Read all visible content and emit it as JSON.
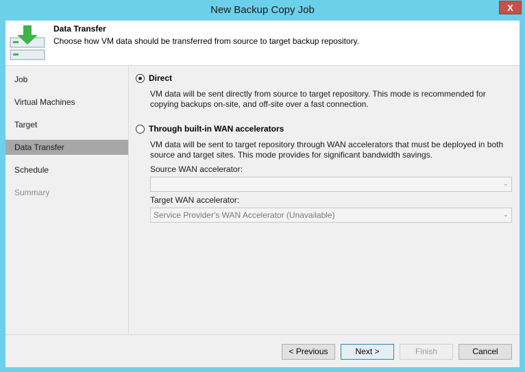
{
  "window": {
    "title": "New Backup Copy Job",
    "close_glyph": "X"
  },
  "header": {
    "title": "Data Transfer",
    "description": "Choose how VM data should be transferred from source to target backup repository.",
    "icon": "data-transfer-arrow-icon"
  },
  "nav": {
    "items": [
      {
        "label": "Job",
        "state": "normal"
      },
      {
        "label": "Virtual Machines",
        "state": "normal"
      },
      {
        "label": "Target",
        "state": "normal"
      },
      {
        "label": "Data Transfer",
        "state": "active"
      },
      {
        "label": "Schedule",
        "state": "normal"
      },
      {
        "label": "Summary",
        "state": "disabled"
      }
    ]
  },
  "options": {
    "direct": {
      "label": "Direct",
      "checked": true,
      "description": "VM data will be sent directly from source to target repository. This mode is recommended for copying backups on-site, and off-site over a fast connection."
    },
    "wan": {
      "label": "Through built-in WAN accelerators",
      "checked": false,
      "description": "VM data will be sent to target repository through WAN accelerators that must be deployed in both source and target sites. This mode provides for significant bandwidth savings."
    }
  },
  "source_wan": {
    "label": "Source WAN accelerator:",
    "value": ""
  },
  "target_wan": {
    "label": "Target WAN accelerator:",
    "value": "Service Provider's WAN Accelerator (Unavailable)"
  },
  "buttons": {
    "previous": "< Previous",
    "next": "Next >",
    "finish": "Finish",
    "cancel": "Cancel"
  },
  "colors": {
    "titlebar": "#6cd0ea",
    "close": "#c7504b",
    "accent_green": "#3fb549"
  }
}
